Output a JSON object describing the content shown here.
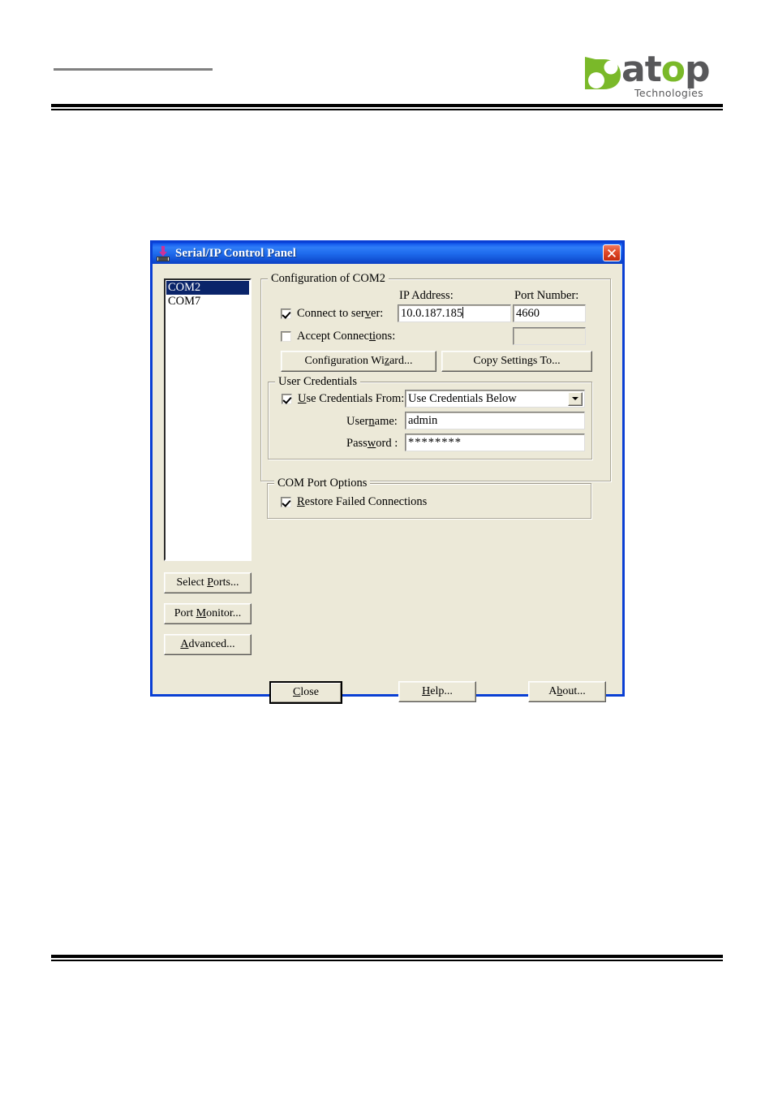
{
  "page": {
    "logo": {
      "wordmark_a": "at",
      "wordmark_o": "o",
      "wordmark_p": "p",
      "tagline": "Technologies",
      "green": "#7ab929",
      "gray": "#58585a"
    }
  },
  "dialog": {
    "title": "Serial/IP Control Panel",
    "title_icon": "serial-port-download-icon",
    "close_icon": "close-icon",
    "ports": {
      "items": [
        {
          "label": "COM2",
          "selected": true
        },
        {
          "label": "COM7",
          "selected": false
        }
      ]
    },
    "side_buttons": [
      {
        "label_pre": "Select ",
        "label_key": "P",
        "label_post": "orts..."
      },
      {
        "label_pre": "Port ",
        "label_key": "M",
        "label_post": "onitor..."
      },
      {
        "label_pre": "",
        "label_key": "A",
        "label_post": "dvanced..."
      }
    ],
    "configuration": {
      "group_title": "Configuration of COM2",
      "ip_label": "IP Address:",
      "port_label": "Port Number:",
      "connect_to_server": {
        "label_pre": "Connect to ser",
        "label_key": "v",
        "label_post": "er:",
        "checked": true
      },
      "accept_connections": {
        "label_pre": "Accept Connec",
        "label_key": "ti",
        "label_post": "ons:",
        "checked": false
      },
      "ip_value": "10.0.187.185",
      "port_value": "4660",
      "accept_port_value": "",
      "wizard_button": {
        "pre": "Configuration Wi",
        "key": "z",
        "post": "ard..."
      },
      "copy_button": {
        "pre": "Copy Settings To...",
        "key": "",
        "post": ""
      }
    },
    "user_credentials": {
      "group_title": "User Credentials",
      "use_credentials": {
        "label_pre": "",
        "label_key": "U",
        "label_post": "se Credentials From:",
        "checked": true
      },
      "source_value": "Use Credentials Below",
      "username_label_pre": "User",
      "username_label_key": "n",
      "username_label_post": "ame:",
      "username_value": "admin",
      "password_label_pre": "Pass",
      "password_label_key": "w",
      "password_label_post": "ord :",
      "password_value": "********"
    },
    "com_port_options": {
      "group_title": "COM Port Options",
      "restore_failed": {
        "label_pre": "",
        "label_key": "R",
        "label_post": "estore Failed Connections",
        "checked": true
      }
    },
    "bottom_buttons": [
      {
        "pre": "",
        "key": "C",
        "post": "lose",
        "default": true
      },
      {
        "pre": "",
        "key": "H",
        "post": "elp...",
        "default": false
      },
      {
        "pre": "A",
        "key": "b",
        "post": "out...",
        "default": false
      }
    ]
  }
}
